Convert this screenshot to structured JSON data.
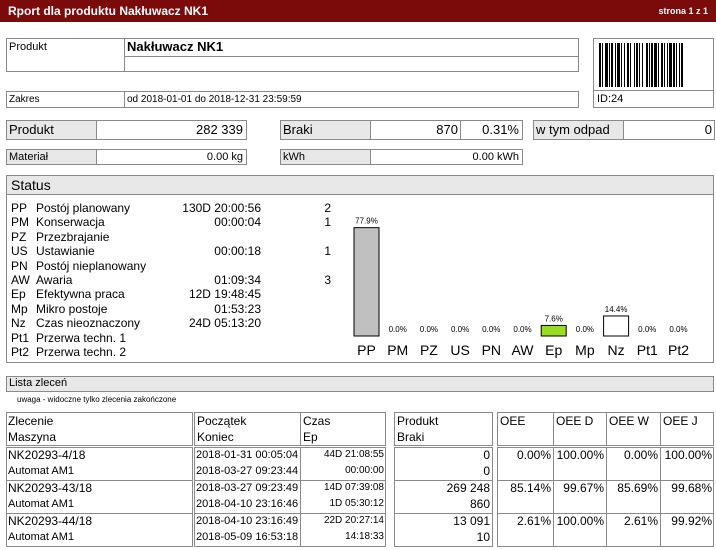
{
  "header": {
    "title": "Rport dla produktu Nakłuwacz NK1",
    "page": "strona 1 z 1"
  },
  "product": {
    "label": "Produkt",
    "name": "Nakłuwacz NK1",
    "id": "ID:24"
  },
  "range": {
    "label": "Zakres",
    "value": "od 2018-01-01 do 2018-12-31 23:59:59"
  },
  "summary": {
    "produkt_label": "Produkt",
    "produkt_value": "282 339",
    "braki_label": "Braki",
    "braki_value": "870",
    "braki_pct": "0.31%",
    "odpad_label": "w tym odpad",
    "odpad_value": "0",
    "material_label": "Materiał",
    "material_value": "0.00 kg",
    "kwh_label": "kWh",
    "kwh_value": "0.00 kWh"
  },
  "status": {
    "title": "Status",
    "rows": [
      {
        "code": "PP",
        "name": "Postój planowany",
        "time": "130D 20:00:56",
        "count": "2"
      },
      {
        "code": "PM",
        "name": "Konserwacja",
        "time": "00:00:04",
        "count": "1"
      },
      {
        "code": "PZ",
        "name": "Przezbrajanie",
        "time": "",
        "count": ""
      },
      {
        "code": "US",
        "name": "Ustawianie",
        "time": "00:00:18",
        "count": "1"
      },
      {
        "code": "PN",
        "name": "Postój nieplanowany",
        "time": "",
        "count": ""
      },
      {
        "code": "AW",
        "name": "Awaria",
        "time": "01:09:34",
        "count": "3"
      },
      {
        "code": "Ep",
        "name": "Efektywna praca",
        "time": "12D 19:48:45",
        "count": ""
      },
      {
        "code": "Mp",
        "name": "Mikro postoje",
        "time": "01:53:23",
        "count": ""
      },
      {
        "code": "Nz",
        "name": "Czas nieoznaczony",
        "time": "24D 05:13:20",
        "count": ""
      },
      {
        "code": "Pt1",
        "name": "Przerwa techn. 1",
        "time": "",
        "count": ""
      },
      {
        "code": "Pt2",
        "name": "Przerwa techn. 2",
        "time": "",
        "count": ""
      }
    ]
  },
  "chart_data": {
    "type": "bar",
    "categories": [
      "PP",
      "PM",
      "PZ",
      "US",
      "PN",
      "AW",
      "Ep",
      "Mp",
      "Nz",
      "Pt1",
      "Pt2"
    ],
    "values": [
      77.9,
      0.0,
      0.0,
      0.0,
      0.0,
      0.0,
      7.6,
      0.0,
      14.4,
      0.0,
      0.0
    ],
    "labels": [
      "77.9%",
      "0.0%",
      "0.0%",
      "0.0%",
      "0.0%",
      "0.0%",
      "7.6%",
      "0.0%",
      "14.4%",
      "0.0%",
      "0.0%"
    ],
    "colors": [
      "#c0c0c0",
      "#ffffff",
      "#ffffff",
      "#ffffff",
      "#ffffff",
      "#ffffff",
      "#99dd22",
      "#ffffff",
      "#ffffff",
      "#ffffff",
      "#ffffff"
    ],
    "ylim": [
      0,
      100
    ]
  },
  "orders": {
    "title": "Lista zleceń",
    "note": "uwaga - widoczne tylko zlecenia zakończone",
    "headers": {
      "zlecenie": "Zlecenie",
      "maszyna": "Maszyna",
      "poczatek": "Początek",
      "koniec": "Koniec",
      "czas": "Czas",
      "ep": "Ep",
      "produkt": "Produkt",
      "braki": "Braki",
      "oee": "OEE",
      "oeed": "OEE D",
      "oeew": "OEE W",
      "oeej": "OEE J"
    },
    "rows": [
      {
        "zlecenie": "NK20293-4/18",
        "maszyna": "Automat AM1",
        "poczatek": "2018-01-31 00:05:04",
        "koniec": "2018-03-27 09:23:44",
        "czas": "44D 21:08:55",
        "ep": "00:00:00",
        "produkt": "0",
        "braki": "0",
        "oee": "0.00%",
        "oeed": "100.00%",
        "oeew": "0.00%",
        "oeej": "100.00%"
      },
      {
        "zlecenie": "NK20293-43/18",
        "maszyna": "Automat AM1",
        "poczatek": "2018-03-27 09:23:49",
        "koniec": "2018-04-10 23:16:46",
        "czas": "14D 07:39:08",
        "ep": "1D 05:30:12",
        "produkt": "269 248",
        "braki": "860",
        "oee": "85.14%",
        "oeed": "99.67%",
        "oeew": "85.69%",
        "oeej": "99.68%"
      },
      {
        "zlecenie": "NK20293-44/18",
        "maszyna": "Automat AM1",
        "poczatek": "2018-04-10 23:16:49",
        "koniec": "2018-05-09 16:53:18",
        "czas": "22D 20:27:14",
        "ep": "14:18:33",
        "produkt": "13 091",
        "braki": "10",
        "oee": "2.61%",
        "oeed": "100.00%",
        "oeew": "2.61%",
        "oeej": "99.92%"
      }
    ]
  }
}
